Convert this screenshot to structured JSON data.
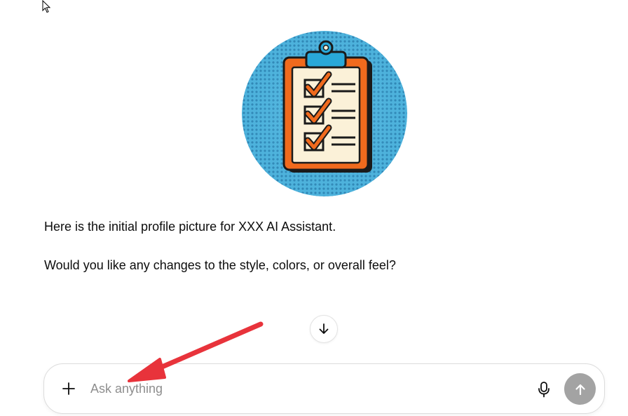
{
  "conversation": {
    "avatar": {
      "icon": "clipboard-checklist-icon",
      "colors": {
        "circle": "#4db2dc",
        "clipboard": "#f06a1d",
        "paper": "#fbf1d8",
        "clip": "#29a8d8",
        "check": "#f06a1d",
        "outline": "#1a1a1a"
      }
    },
    "message_line_1": "Here is the initial profile picture for XXX AI Assistant.",
    "message_line_2": "Would you like any changes to the style, colors, or overall feel?"
  },
  "scroll_down": {
    "icon": "arrow-down-icon"
  },
  "composer": {
    "placeholder": "Ask anything",
    "value": "",
    "add_icon": "plus-icon",
    "mic_icon": "microphone-icon",
    "send_icon": "arrow-up-icon",
    "send_color": "#a3a3a3"
  },
  "annotation": {
    "color": "#e8333b",
    "icon": "red-arrow-annotation"
  }
}
